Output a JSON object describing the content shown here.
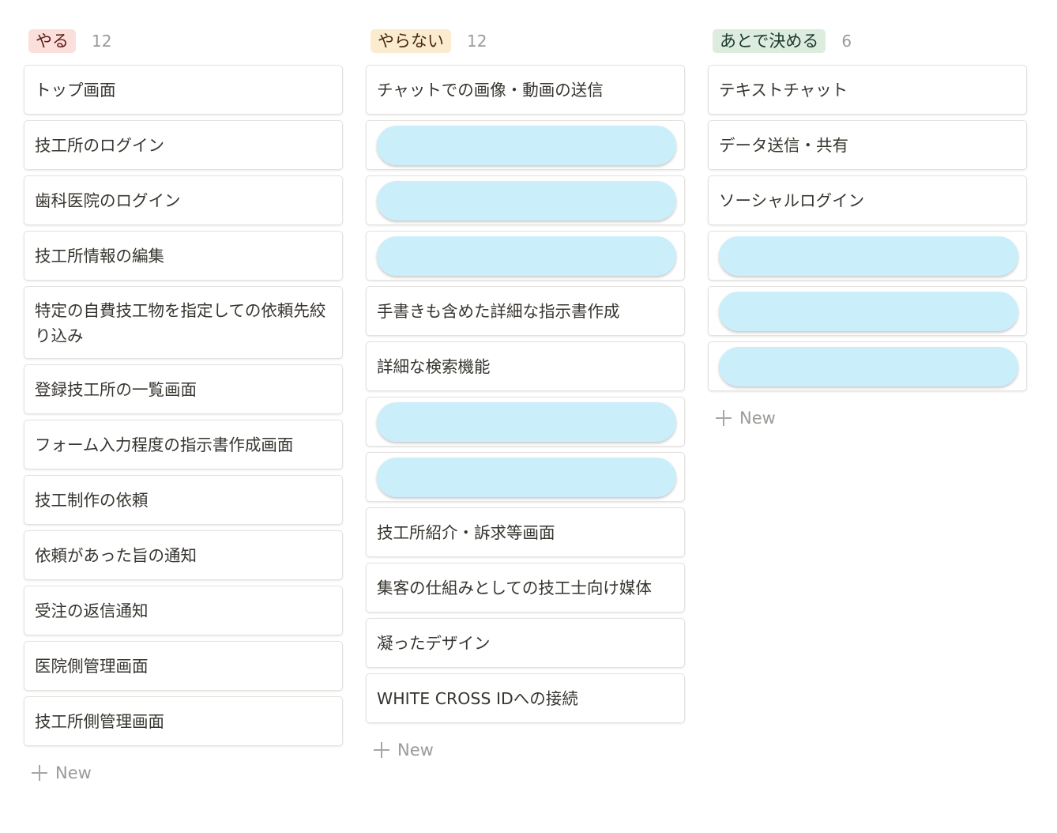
{
  "colors": {
    "tag_do_bg": "#fbdfdb",
    "tag_do_fg": "#5d1715",
    "tag_dont_bg": "#fbecd0",
    "tag_dont_fg": "#49290e",
    "tag_later_bg": "#dcecdf",
    "tag_later_fg": "#1c3829",
    "redaction": "#cbeefb"
  },
  "columns": [
    {
      "tag": "やる",
      "count": "12",
      "new_label": "New",
      "cards": [
        {
          "title": "トップ画面"
        },
        {
          "title": "技工所のログイン"
        },
        {
          "title": "歯科医院のログイン"
        },
        {
          "title": "技工所情報の編集"
        },
        {
          "title": "特定の自費技工物を指定しての依頼先絞り込み"
        },
        {
          "title": "登録技工所の一覧画面"
        },
        {
          "title": "フォーム入力程度の指示書作成画面"
        },
        {
          "title": "技工制作の依頼"
        },
        {
          "title": "依頼があった旨の通知"
        },
        {
          "title": "受注の返信通知"
        },
        {
          "title": "医院側管理画面"
        },
        {
          "title": "技工所側管理画面"
        }
      ]
    },
    {
      "tag": "やらない",
      "count": "12",
      "new_label": "New",
      "cards": [
        {
          "title": "チャットでの画像・動画の送信"
        },
        {
          "redacted": true
        },
        {
          "redacted": true
        },
        {
          "redacted": true
        },
        {
          "title": "手書きも含めた詳細な指示書作成"
        },
        {
          "title": "詳細な検索機能"
        },
        {
          "redacted": true
        },
        {
          "redacted": true
        },
        {
          "title": "技工所紹介・訴求等画面"
        },
        {
          "title": "集客の仕組みとしての技工士向け媒体"
        },
        {
          "title": "凝ったデザイン"
        },
        {
          "title": "WHITE CROSS IDへの接続"
        }
      ]
    },
    {
      "tag": "あとで決める",
      "count": "6",
      "new_label": "New",
      "cards": [
        {
          "title": "テキストチャット"
        },
        {
          "title": "データ送信・共有"
        },
        {
          "title": "ソーシャルログイン"
        },
        {
          "redacted": true
        },
        {
          "redacted": true
        },
        {
          "redacted": true
        }
      ]
    }
  ]
}
